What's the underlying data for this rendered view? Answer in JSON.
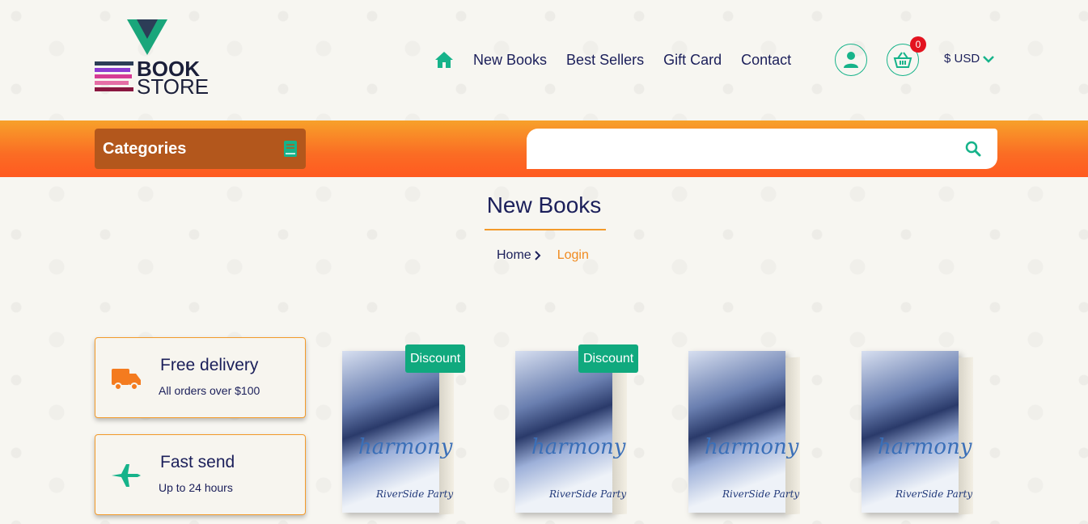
{
  "brand": {
    "line1": "BOOK",
    "line2": "STORE"
  },
  "nav": {
    "home_icon": "home-icon",
    "links": [
      "New Books",
      "Best Sellers",
      "Gift Card",
      "Contact"
    ]
  },
  "cart": {
    "count": "0"
  },
  "currency": {
    "label": "$ USD"
  },
  "categories": {
    "label": "Categories",
    "icon": "book-icon"
  },
  "search": {
    "placeholder": "",
    "value": ""
  },
  "page": {
    "title": "New Books",
    "breadcrumb": {
      "home": "Home",
      "current": "Login"
    }
  },
  "features": [
    {
      "title": "Free delivery",
      "subtitle": "All orders over $100",
      "icon": "truck-icon"
    },
    {
      "title": "Fast send",
      "subtitle": "Up to 24 hours",
      "icon": "airplane-icon"
    }
  ],
  "books": [
    {
      "cover_title": "harmony",
      "cover_bottom": "RiverSide Party",
      "badge": "Discount"
    },
    {
      "cover_title": "harmony",
      "cover_bottom": "RiverSide Party",
      "badge": "Discount"
    },
    {
      "cover_title": "harmony",
      "cover_bottom": "RiverSide Party",
      "badge": ""
    },
    {
      "cover_title": "harmony",
      "cover_bottom": "RiverSide Party",
      "badge": ""
    }
  ],
  "colors": {
    "accent": "#16b38a",
    "orange": "#f39a2a",
    "navy": "#1b1f5a",
    "badge_red": "#e3131f"
  }
}
